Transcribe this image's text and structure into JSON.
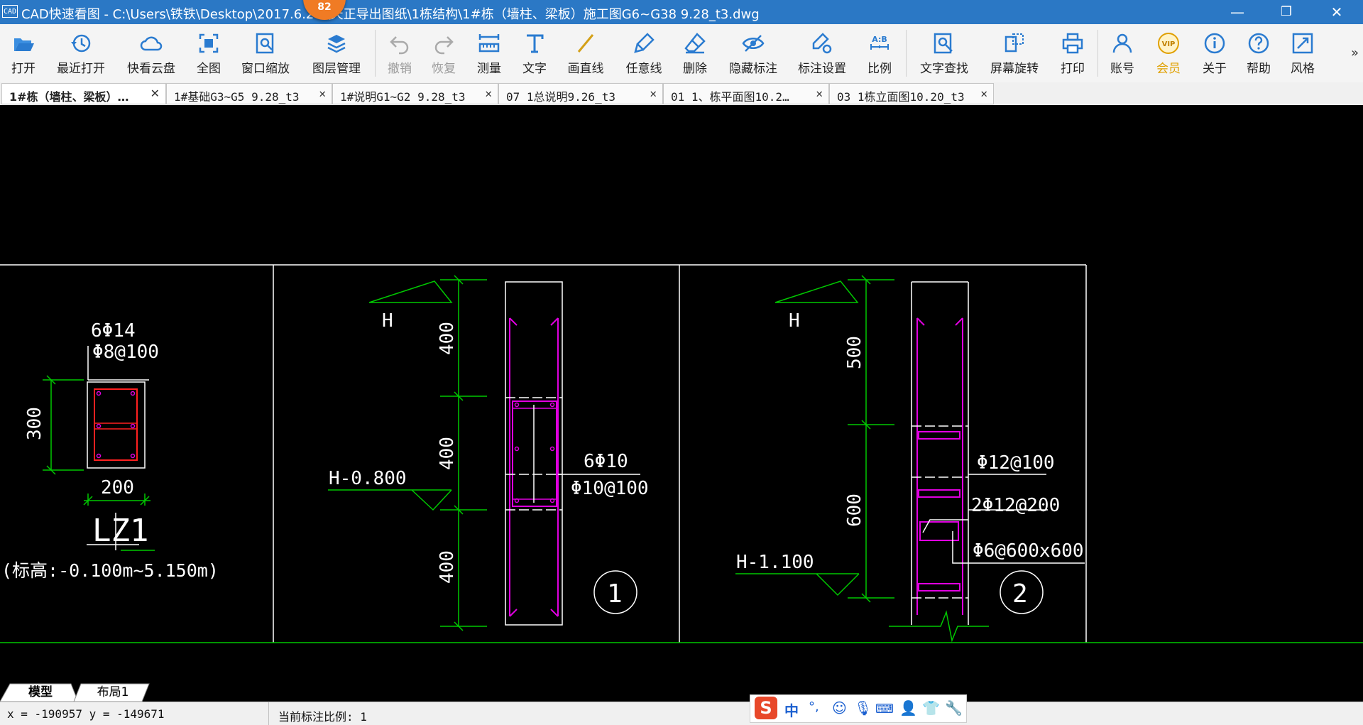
{
  "window": {
    "app_icon_text": "CAD",
    "title": "CAD快速看图 - C:\\Users\\铁铁\\Desktop\\2017.6.26   \\天正导出图纸\\1栋结构\\1#栋（墙柱、梁板）施工图G6~G38 9.28_t3.dwg",
    "badge": "82",
    "minimize": "—",
    "restore": "❐",
    "close": "✕"
  },
  "toolbar": {
    "items": [
      {
        "label": "打开",
        "icon": "open-folder-icon"
      },
      {
        "label": "最近打开",
        "icon": "recent-clock-icon"
      },
      {
        "label": "快看云盘",
        "icon": "cloud-icon"
      },
      {
        "label": "全图",
        "icon": "fit-all-icon"
      },
      {
        "label": "窗口缩放",
        "icon": "window-zoom-icon"
      },
      {
        "label": "图层管理",
        "icon": "layers-icon"
      },
      {
        "label": "撤销",
        "icon": "undo-icon",
        "disabled": true
      },
      {
        "label": "恢复",
        "icon": "redo-icon",
        "disabled": true
      },
      {
        "label": "测量",
        "icon": "ruler-icon"
      },
      {
        "label": "文字",
        "icon": "text-icon"
      },
      {
        "label": "画直线",
        "icon": "line-icon"
      },
      {
        "label": "任意线",
        "icon": "freehand-icon"
      },
      {
        "label": "删除",
        "icon": "eraser-icon"
      },
      {
        "label": "隐藏标注",
        "icon": "hide-eye-icon"
      },
      {
        "label": "标注设置",
        "icon": "annotation-settings-icon"
      },
      {
        "label": "比例",
        "icon": "scale-icon",
        "icon_text": "A:B"
      },
      {
        "label": "文字查找",
        "icon": "text-search-icon"
      },
      {
        "label": "屏幕旋转",
        "icon": "rotate-screen-icon"
      },
      {
        "label": "打印",
        "icon": "printer-icon"
      },
      {
        "label": "账号",
        "icon": "user-icon"
      },
      {
        "label": "会员",
        "icon": "vip-icon",
        "icon_text": "VIP"
      },
      {
        "label": "关于",
        "icon": "info-icon"
      },
      {
        "label": "帮助",
        "icon": "help-icon"
      },
      {
        "label": "风格",
        "icon": "style-icon"
      }
    ],
    "more": "»"
  },
  "tabs": [
    {
      "label": "1#栋（墙柱、梁板）…",
      "active": true
    },
    {
      "label": "1#基础G3~G5 9.28_t3"
    },
    {
      "label": "1#说明G1~G2 9.28_t3"
    },
    {
      "label": "07 1总说明9.26_t3"
    },
    {
      "label": "01  1、栋平面图10.2…"
    },
    {
      "label": "03  1栋立面图10.20_t3"
    }
  ],
  "tab_close": "✕",
  "drawing": {
    "lz1": {
      "rebar_main": "6Φ14",
      "rebar_stirrup": "Φ8@100",
      "height_dim": "300",
      "width_dim": "200",
      "name": "LZ1",
      "elevation_note": "(标高:-0.100m~5.150m)"
    },
    "detail1": {
      "level_top": "H",
      "level_bottom": "H-0.800",
      "dims": [
        "400",
        "400",
        "400"
      ],
      "rebar_main": "6Φ10",
      "rebar_stirrup": "Φ10@100",
      "number": "1"
    },
    "detail2": {
      "level_top": "H",
      "level_bottom": "H-1.100",
      "dims": [
        "500",
        "600"
      ],
      "note1": "Φ12@100",
      "note2": "2Φ12@200",
      "note3": "Φ6@600x600",
      "number": "2"
    }
  },
  "layout_tabs": [
    "模型",
    "布局1"
  ],
  "status": {
    "coords": "x = -190957 y = -149671",
    "scale": "当前标注比例: 1"
  },
  "ime": {
    "logo": "S",
    "mode": "中",
    "punct": "°,",
    "icons": [
      "emoji-icon",
      "mic-icon",
      "keyboard-icon",
      "user-icon",
      "shirt-icon",
      "wrench-icon"
    ]
  },
  "colors": {
    "titlebar": "#2b78c5",
    "cad_green": "#00c800",
    "cad_magenta": "#e000e0",
    "cad_red": "#ff2020",
    "cad_white": "#ffffff",
    "badge": "#f07b24"
  }
}
